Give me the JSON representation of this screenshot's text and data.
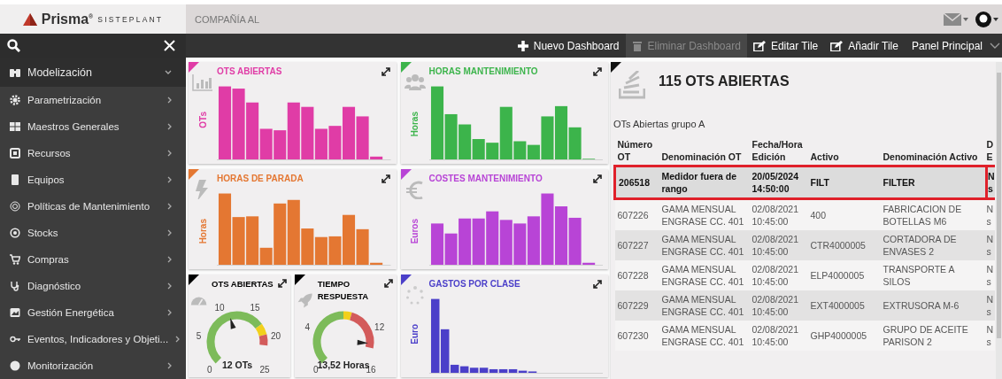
{
  "header": {
    "brand": "Prisma",
    "brand_mark": "®",
    "tagline": "SISTEPLANT",
    "company": "COMPAÑÍA AL"
  },
  "toolbar": {
    "buttons": [
      {
        "label": "Nuevo Dashboard",
        "disabled": false
      },
      {
        "label": "Eliminar Dashboard",
        "disabled": true
      },
      {
        "label": "Editar Tile",
        "disabled": false
      },
      {
        "label": "Añadir Tile",
        "disabled": false
      }
    ],
    "panel": "Panel Principal"
  },
  "sidebar": {
    "items": [
      {
        "label": "Modelización",
        "expanded": true
      },
      {
        "label": "Parametrización",
        "expanded": false
      },
      {
        "label": "Maestros Generales",
        "expanded": false
      },
      {
        "label": "Recursos",
        "expanded": false
      },
      {
        "label": "Equipos",
        "expanded": false
      },
      {
        "label": "Políticas de Mantenimiento",
        "expanded": false
      },
      {
        "label": "Stocks",
        "expanded": false
      },
      {
        "label": "Compras",
        "expanded": false
      },
      {
        "label": "Diagnóstico",
        "expanded": false
      },
      {
        "label": "Gestión Energética",
        "expanded": false
      },
      {
        "label": "Eventos, Indicadores y Objeti...",
        "expanded": false
      },
      {
        "label": "Monitorización",
        "expanded": false
      }
    ]
  },
  "tiles": [
    {
      "kind": "bar",
      "title": "OTS ABIERTAS",
      "axis_label": "OTs",
      "color": "#e03ca6"
    },
    {
      "kind": "bar",
      "title": "HORAS MANTENIMIENTO",
      "axis_label": "Horas",
      "color": "#3cb44b"
    },
    {
      "kind": "bar",
      "title": "HORAS DE PARADA",
      "axis_label": "Horas",
      "color": "#e47732"
    },
    {
      "kind": "bar",
      "title": "COSTES MANTENIMIENTO",
      "axis_label": "Euros",
      "color": "#b844d6"
    },
    {
      "kind": "gauge",
      "title": "OTS ABIERTAS",
      "color": "#000000",
      "scale": [
        "0",
        "5",
        "10",
        "15",
        "20",
        "25"
      ],
      "value": "12 OTs"
    },
    {
      "kind": "gauge",
      "title": "TIEMPO RESPUESTA",
      "color": "#000000",
      "scale": [
        "0",
        "4",
        "12",
        "16"
      ],
      "value": "13,52 Horas"
    },
    {
      "kind": "bar",
      "title": "GASTOS POR CLASE",
      "axis_label": "Euro",
      "color": "#4b3fc9"
    }
  ],
  "table_tile": {
    "title": "115 OTS ABIERTAS",
    "subtitle": "OTs Abiertas grupo A",
    "columns": [
      "Número OT",
      "Denominación OT",
      "Fecha/Hora Edición",
      "Activo",
      "Denominación Activo",
      "D E"
    ],
    "rows": [
      {
        "cells": [
          "206518",
          "Medidor fuera de rango",
          "20/05/2024 14:50:00",
          "FILT",
          "FILTER",
          "N s"
        ],
        "selected": true
      },
      {
        "cells": [
          "607226",
          "GAMA MENSUAL ENGRASE CC. 401",
          "02/08/2021 10:45:00",
          "400",
          "FABRICACION DE BOTELLAS M6",
          "N s"
        ],
        "selected": false
      },
      {
        "cells": [
          "607227",
          "GAMA MENSUAL ENGRASE CC. 401",
          "02/08/2021 10:45:00",
          "CTR4000005",
          "CORTADORA DE ENVASES 2",
          "N s"
        ],
        "selected": false
      },
      {
        "cells": [
          "607228",
          "GAMA MENSUAL ENGRASE CC. 401",
          "02/08/2021 10:45:00",
          "ELP4000005",
          "TRANSPORTE A SILOS",
          "N s"
        ],
        "selected": false
      },
      {
        "cells": [
          "607229",
          "GAMA MENSUAL ENGRASE CC. 401",
          "02/08/2021 10:45:00",
          "EXT4000005",
          "EXTRUSORA M-6",
          "N s"
        ],
        "selected": false
      },
      {
        "cells": [
          "607230",
          "GAMA MENSUAL ENGRASE CC. 401",
          "02/08/2021 10:45:00",
          "GHP4000005",
          "GRUPO DE ACEITE PARISON 2",
          "N s"
        ],
        "selected": false
      }
    ]
  }
}
